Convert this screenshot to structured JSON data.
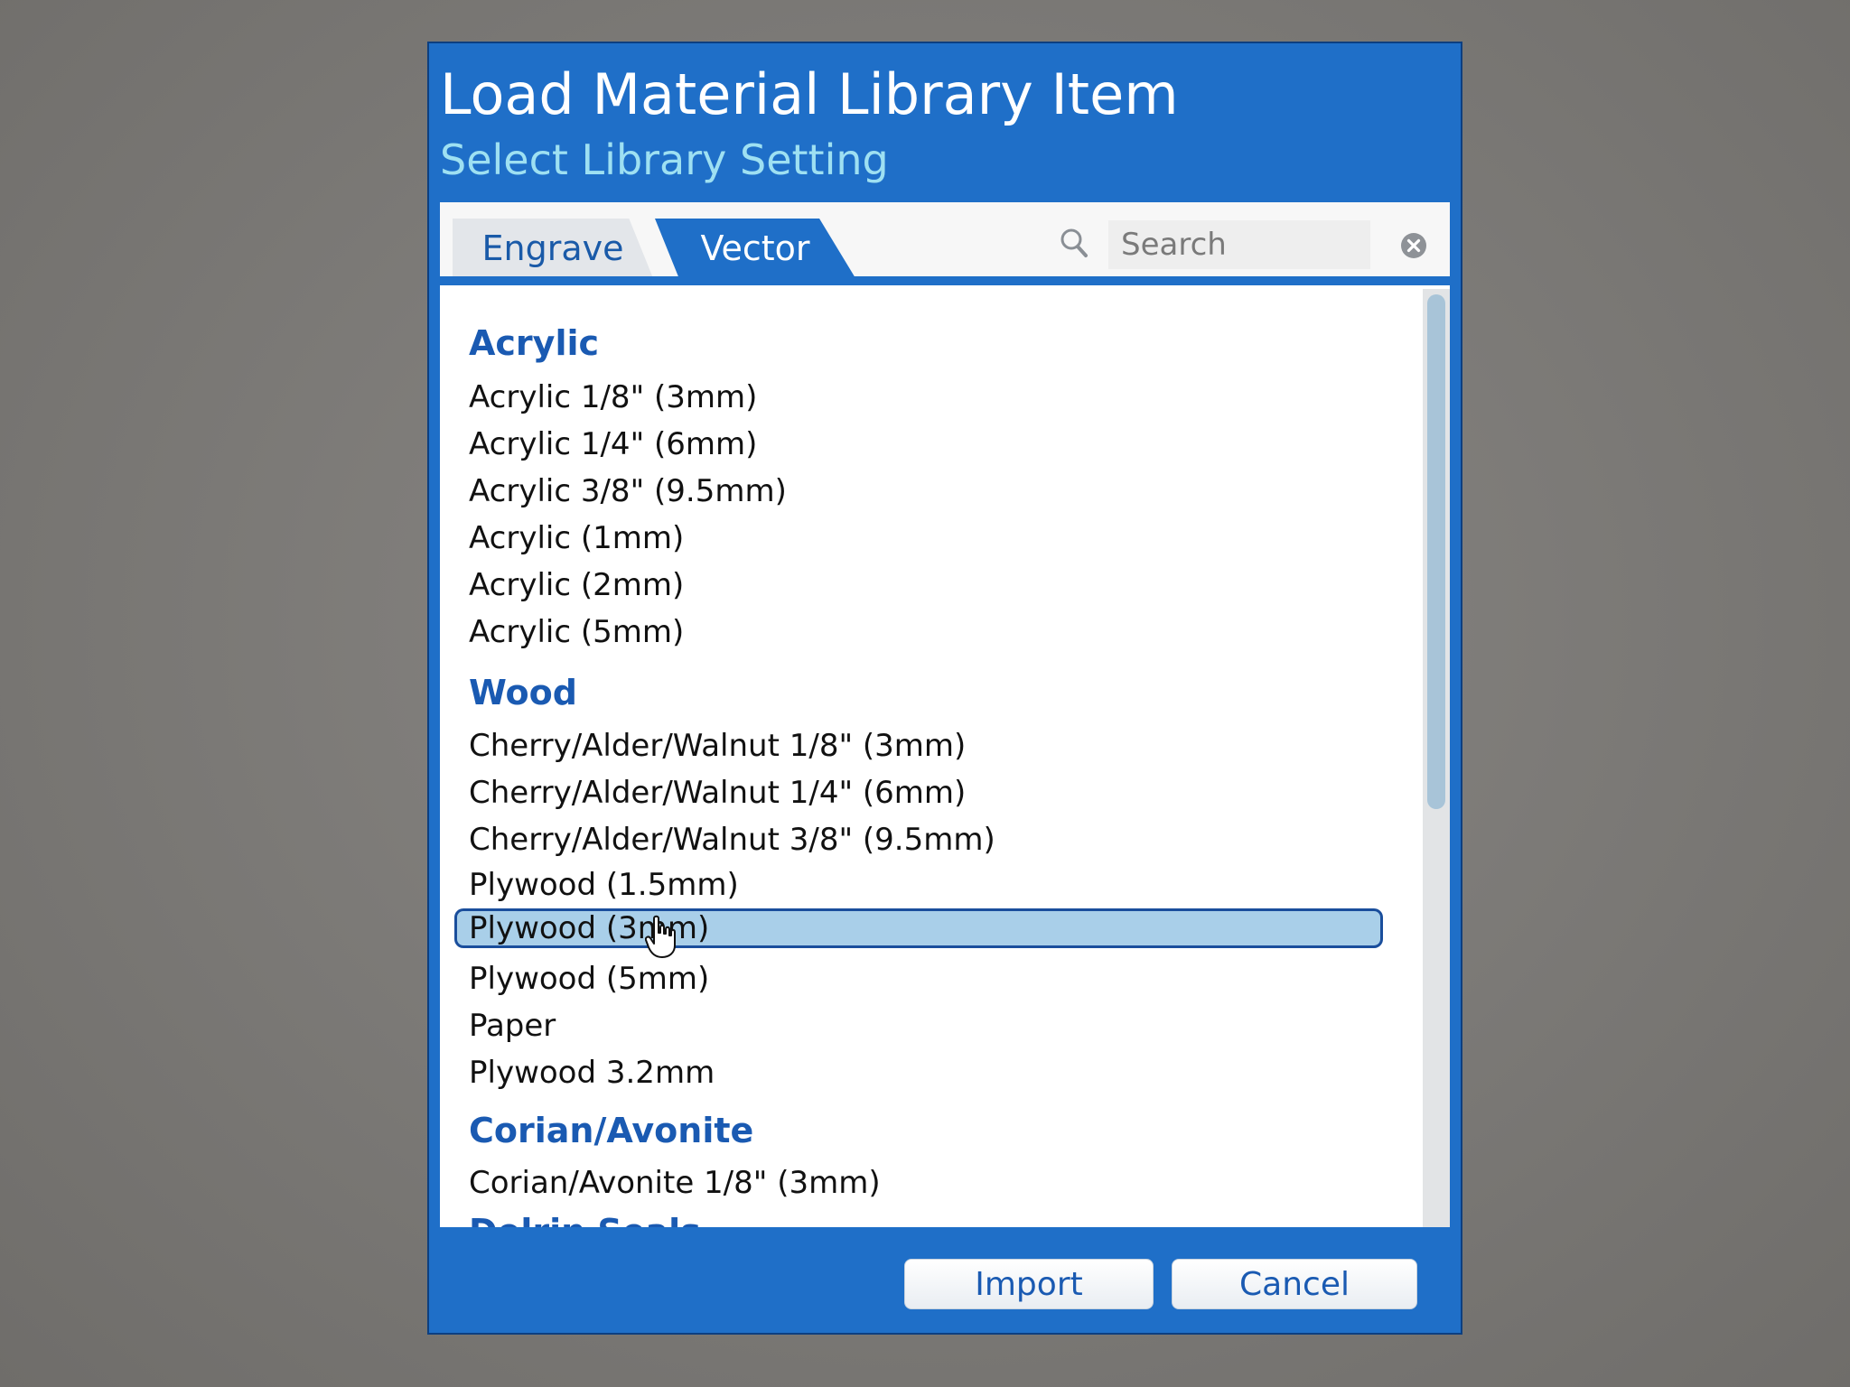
{
  "dialog": {
    "title": "Load Material Library Item",
    "subtitle": "Select Library Setting"
  },
  "tabs": {
    "engrave": "Engrave",
    "vector": "Vector",
    "active": "Vector"
  },
  "search": {
    "placeholder": "Search",
    "value": ""
  },
  "library": {
    "acrylic": {
      "header": "Acrylic",
      "items": [
        "Acrylic 1/8\" (3mm)",
        "Acrylic 1/4\" (6mm)",
        "Acrylic 3/8\" (9.5mm)",
        "Acrylic (1mm)",
        "Acrylic (2mm)",
        "Acrylic (5mm)"
      ]
    },
    "wood": {
      "header": "Wood",
      "items": [
        "Cherry/Alder/Walnut 1/8\" (3mm)",
        "Cherry/Alder/Walnut 1/4\" (6mm)",
        "Cherry/Alder/Walnut 3/8\" (9.5mm)",
        "Plywood (1.5mm)",
        "Plywood (3mm)",
        "Plywood (5mm)",
        "Paper",
        "Plywood 3.2mm"
      ],
      "selected": "Plywood (3mm)"
    },
    "corian": {
      "header": "Corian/Avonite",
      "items": [
        "Corian/Avonite 1/8\" (3mm)"
      ]
    },
    "delrin": {
      "header": "Delrin Seals"
    }
  },
  "buttons": {
    "import": "Import",
    "cancel": "Cancel"
  },
  "colors": {
    "dialog_blue": "#1f6fc8",
    "group_header": "#1a5ab2",
    "selection": "#a9cfe9"
  }
}
